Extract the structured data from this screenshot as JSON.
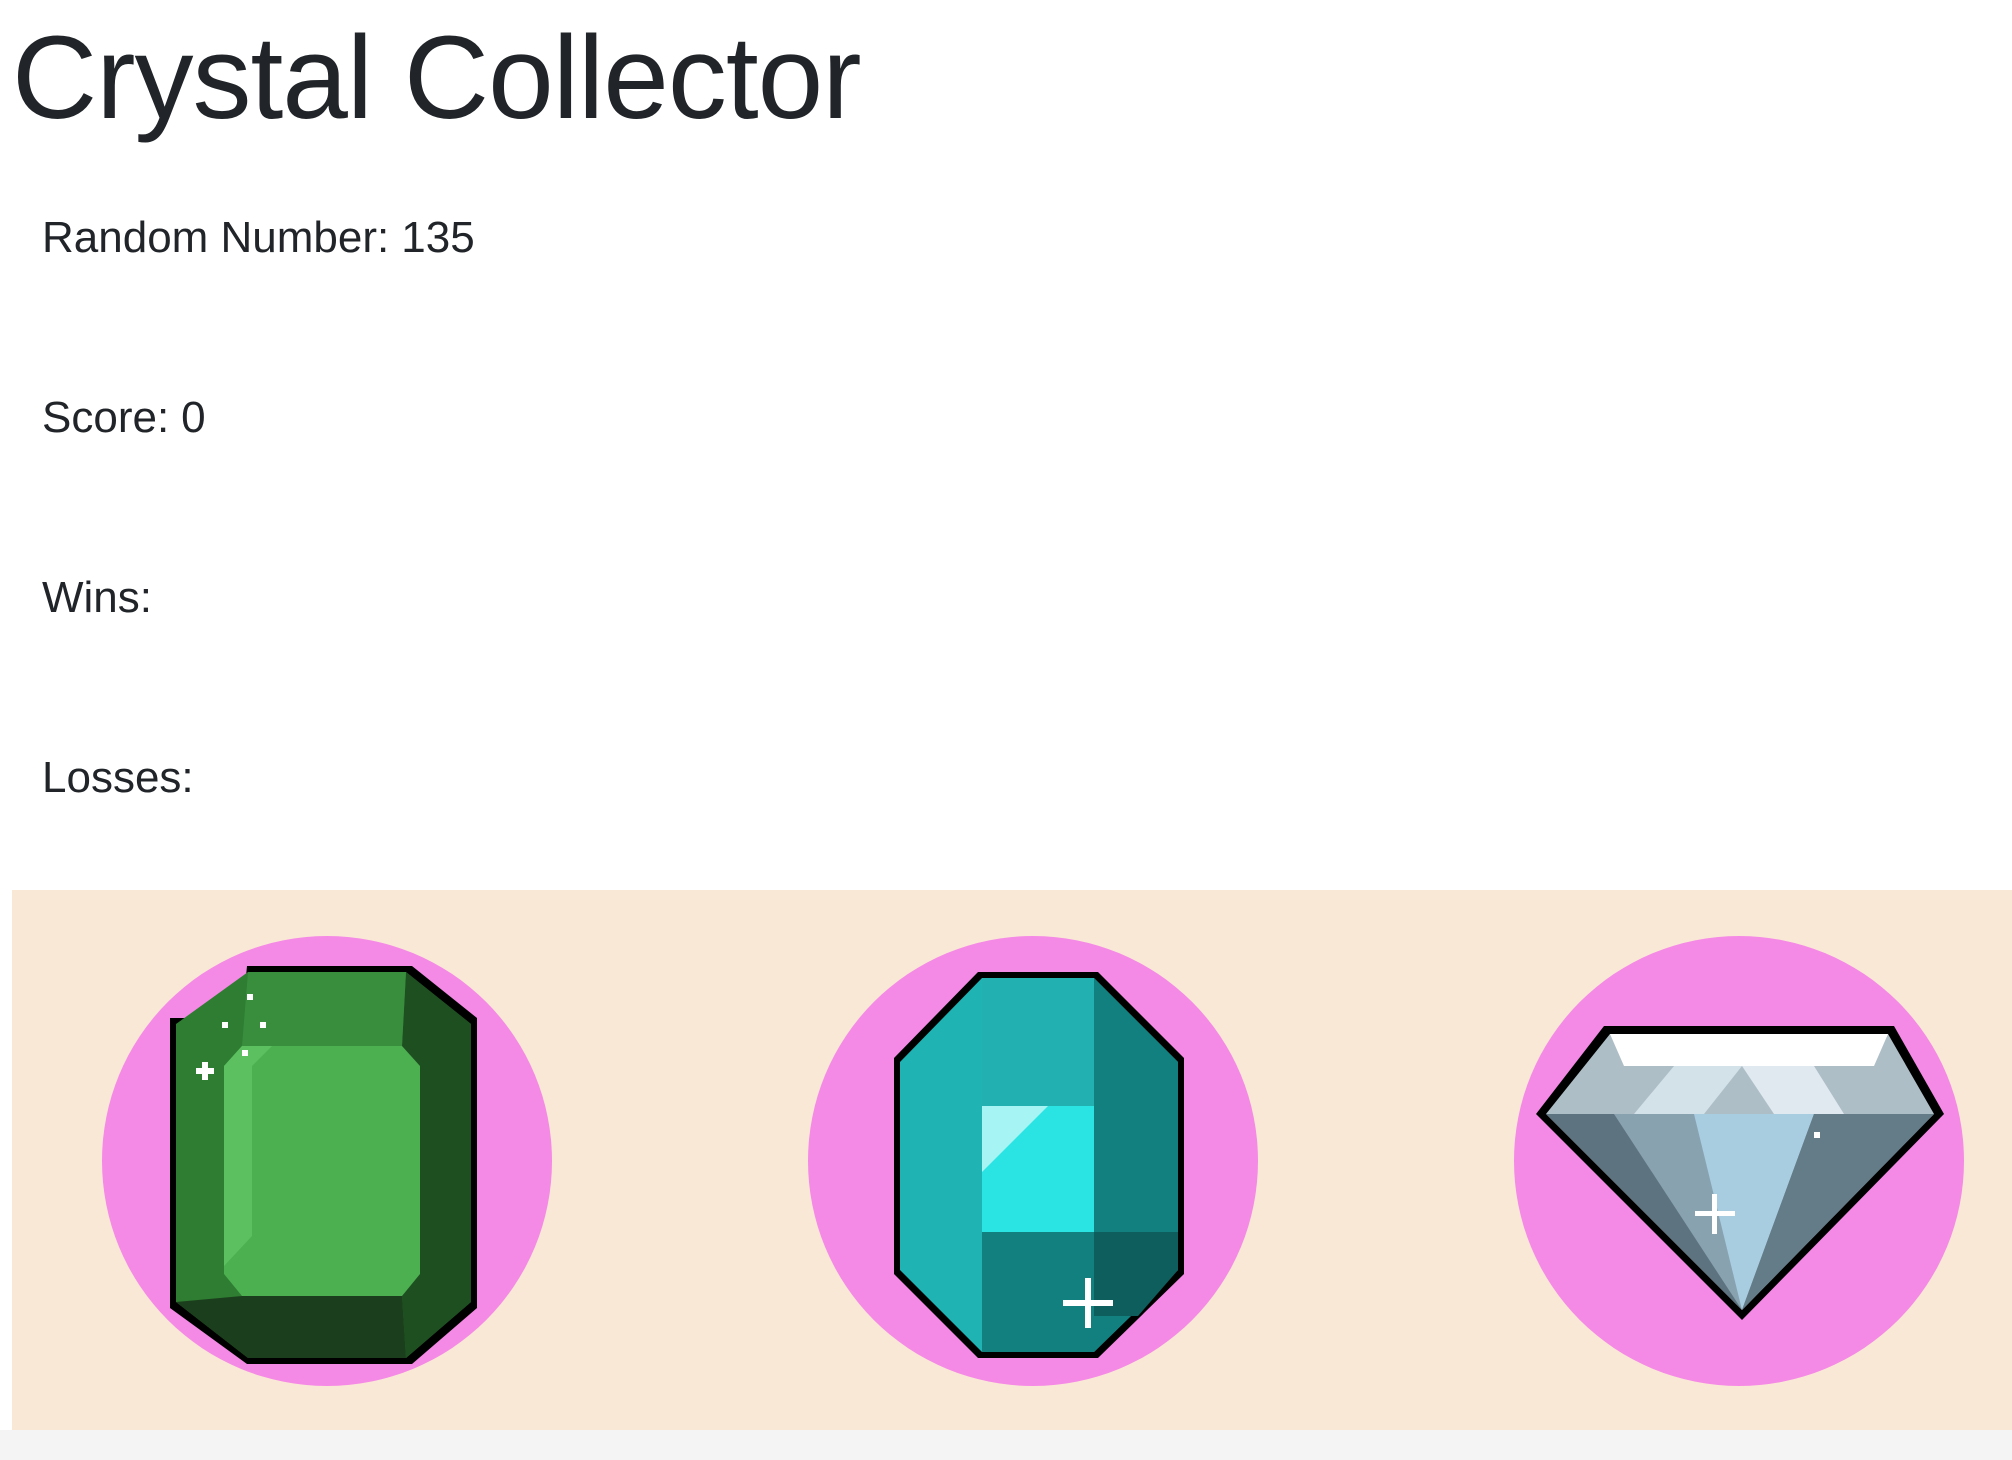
{
  "title": "Crystal Collector",
  "stats": {
    "random_label": "Random Number:",
    "random_value": "135",
    "score_label": "Score:",
    "score_value": "0",
    "wins_label": "Wins:",
    "wins_value": "",
    "losses_label": "Losses:",
    "losses_value": ""
  },
  "crystals": [
    {
      "name": "emerald",
      "icon": "green-emerald-icon",
      "color": "#4caf50"
    },
    {
      "name": "aquamarine",
      "icon": "teal-gem-icon",
      "color": "#1fb3b3"
    },
    {
      "name": "diamond",
      "icon": "diamond-icon",
      "color": "#d8e6ee"
    }
  ],
  "colors": {
    "crystal_area_bg": "#f9e8d6",
    "crystal_circle": "#f589e6",
    "text": "#212529"
  }
}
